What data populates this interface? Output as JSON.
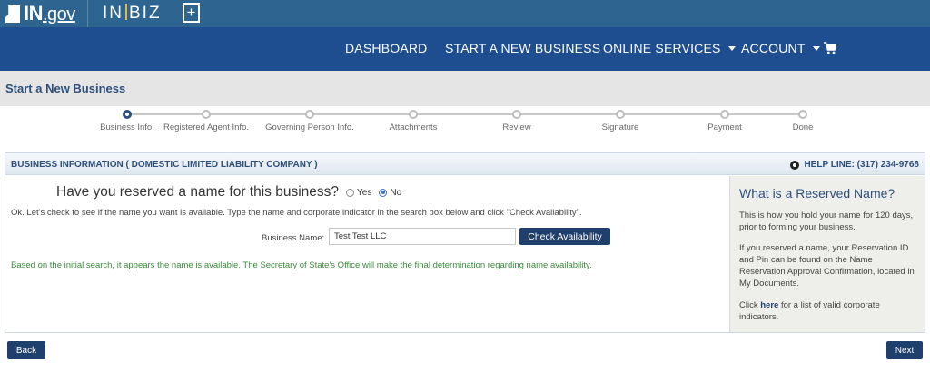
{
  "header": {
    "logo_main": "IN",
    "logo_suffix": ".gov",
    "logo_inbiz_left": "IN",
    "logo_inbiz_right": "BIZ",
    "plus_glyph": "+"
  },
  "nav": {
    "dashboard": "DASHBOARD",
    "start_business": "START A NEW BUSINESS",
    "online_services": "ONLINE SERVICES",
    "account": "ACCOUNT",
    "cart_icon": "cart-icon"
  },
  "page": {
    "title": "Start a New Business"
  },
  "steps": [
    {
      "label": "Business Info.",
      "active": true
    },
    {
      "label": "Registered Agent Info.",
      "active": false
    },
    {
      "label": "Governing Person Info.",
      "active": false
    },
    {
      "label": "Attachments",
      "active": false
    },
    {
      "label": "Review",
      "active": false
    },
    {
      "label": "Signature",
      "active": false
    },
    {
      "label": "Payment",
      "active": false
    },
    {
      "label": "Done",
      "active": false
    }
  ],
  "panel": {
    "title": "BUSINESS INFORMATION  ( DOMESTIC LIMITED LIABILITY COMPANY )",
    "help_line": "HELP LINE: (317) 234-9768",
    "question": "Have you reserved a name for this business?",
    "yes_label": "Yes",
    "no_label": "No",
    "selected": "No",
    "instructions": "Ok. Let's check to see if the name you want is available. Type the name and corporate indicator in the search box below and click \"Check Availability\".",
    "business_name_label": "Business Name:",
    "business_name_value": "Test Test LLC",
    "check_button": "Check Availability",
    "availability_message": "Based on the initial search, it appears the name is available. The Secretary of State's Office will make the final determination regarding name availability."
  },
  "sidebar": {
    "title": "What is a Reserved Name?",
    "p1": "This is how you hold your name for 120 days, prior to forming your business.",
    "p2": "If you reserved a name, your Reservation ID and Pin can be found on the Name Reservation Approval Confirmation, located in My Documents.",
    "p3_pre": "Click ",
    "p3_link": "here",
    "p3_post": " for a list of valid corporate indicators."
  },
  "footer": {
    "back": "Back",
    "next": "Next"
  },
  "colors": {
    "topbar": "#2d6590",
    "navbar": "#1f4e90",
    "button": "#1f3f6c",
    "success_text": "#3a8a3a"
  }
}
